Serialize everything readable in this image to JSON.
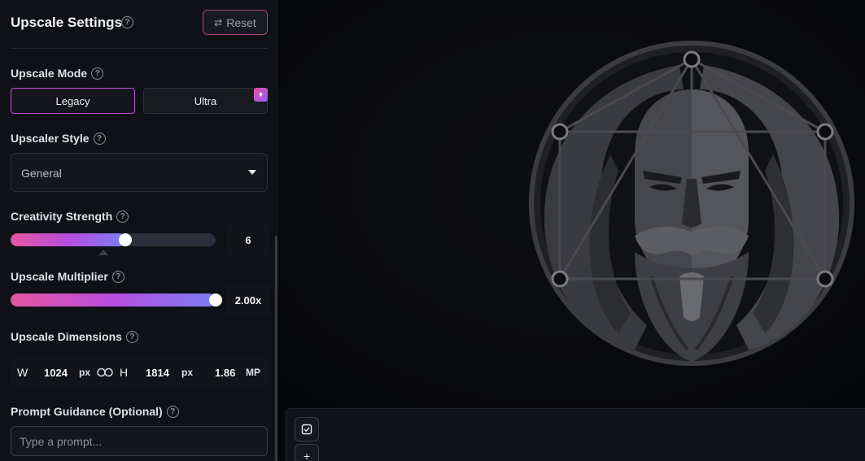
{
  "header": {
    "title": "Upscale Settings",
    "reset_label": "Reset"
  },
  "mode": {
    "label": "Upscale Mode",
    "options": [
      "Legacy",
      "Ultra"
    ],
    "selected": "Legacy"
  },
  "style": {
    "label": "Upscaler Style",
    "value": "General"
  },
  "creativity": {
    "label": "Creativity Strength",
    "value": "6",
    "fraction": 0.56
  },
  "multiplier": {
    "label": "Upscale Multiplier",
    "value": "2.00x",
    "fraction": 1.0
  },
  "dimensions": {
    "label": "Upscale Dimensions",
    "width_label": "W",
    "width": "1024",
    "width_unit": "px",
    "height_label": "H",
    "height": "1814",
    "height_unit": "px",
    "megapixels": "1.86",
    "megapixels_unit": "MP"
  },
  "prompt": {
    "label": "Prompt Guidance (Optional)",
    "placeholder": "Type a prompt..."
  },
  "colors": {
    "accent_gradient_start": "#e5569e",
    "accent_gradient_end": "#7a7df5",
    "selected_border": "#c04fd6",
    "panel_bg": "#0f1117"
  },
  "icons": [
    "help-icon",
    "reset-icon",
    "gem-icon",
    "chevron-down-icon",
    "link-icon",
    "select-checkbox-icon",
    "plus-icon"
  ]
}
